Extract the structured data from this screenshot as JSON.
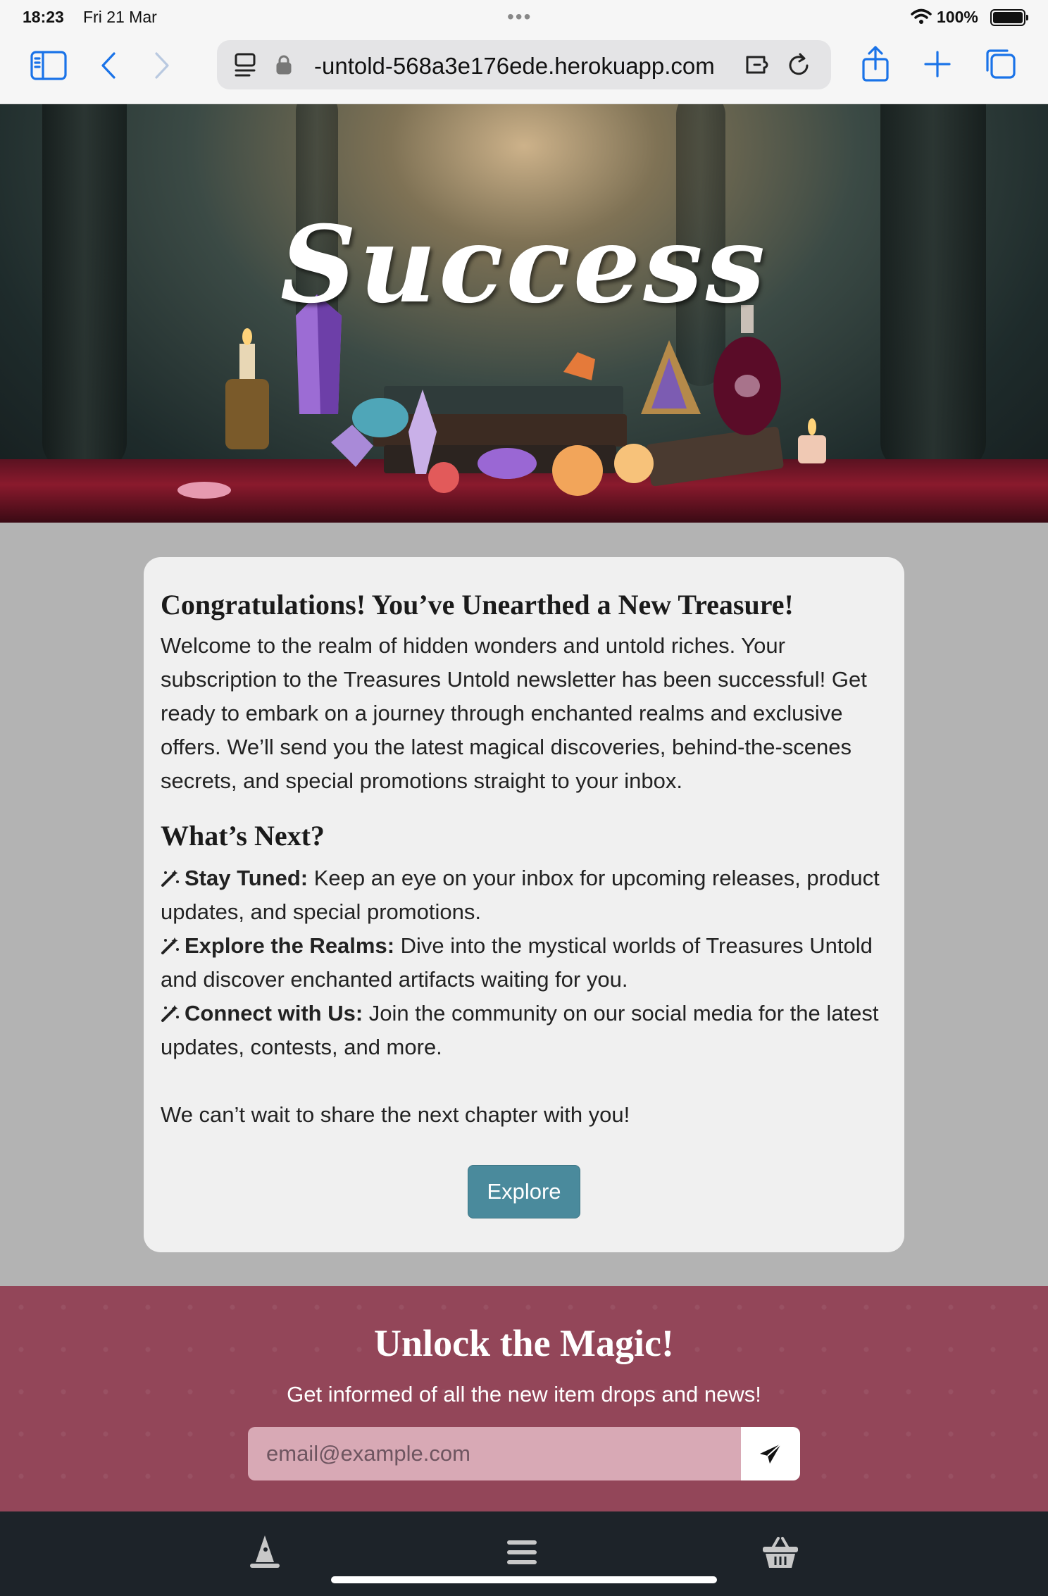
{
  "status_bar": {
    "time": "18:23",
    "date": "Fri 21 Mar",
    "battery": "100%"
  },
  "browser": {
    "url": "-untold-568a3e176ede.herokuapp.com",
    "icons": [
      "sidebar-icon",
      "back-icon",
      "forward-icon",
      "reader-icon",
      "lock-icon",
      "extensions-icon",
      "reload-icon",
      "share-icon",
      "new-tab-icon",
      "tabs-icon"
    ]
  },
  "hero": {
    "title": "Success"
  },
  "card": {
    "title": "Congratulations! You’ve Unearthed a New Treasure!",
    "paragraph": "Welcome to the realm of hidden wonders and untold riches. Your subscription to the Treasures Untold newsletter has been successful! Get ready to embark on a journey through enchanted realms and exclusive offers. We’ll send you the latest magical discoveries, behind-the-scenes secrets, and special promotions straight to your inbox.",
    "subheading": "What’s Next?",
    "items": [
      {
        "label": "Stay Tuned:",
        "text": " Keep an eye on your inbox for upcoming releases, product updates, and special promotions."
      },
      {
        "label": "Explore the Realms:",
        "text": " Dive into the mystical worlds of Treasures Untold and discover enchanted artifacts waiting for you."
      },
      {
        "label": "Connect with Us:",
        "text": " Join the community on our social media for the latest updates, contests, and more."
      }
    ],
    "closing": "We can’t wait to share the next chapter with you!",
    "button": "Explore"
  },
  "newsletter": {
    "title": "Unlock the Magic!",
    "subtitle": "Get informed of all the new item drops and news!",
    "input_placeholder": "email@example.com"
  },
  "bottom_nav": {
    "icons": [
      "wizard-hat-icon",
      "menu-icon",
      "basket-icon"
    ]
  },
  "colors": {
    "button": "#4a8a9c",
    "newsletter_bg": "#934659",
    "nav_bg": "#1d2329",
    "accent": "#1a73e8"
  }
}
